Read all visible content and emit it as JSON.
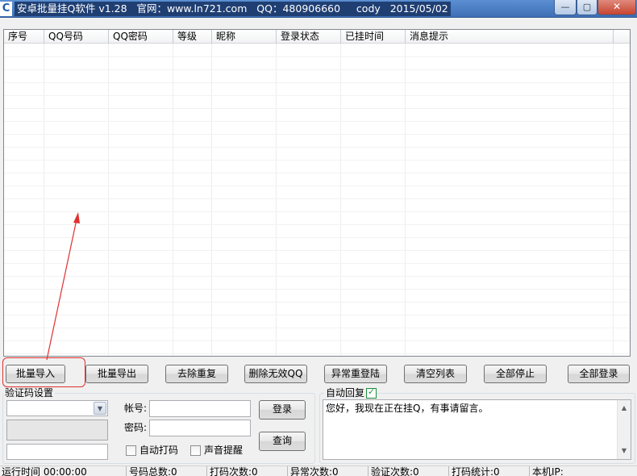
{
  "window": {
    "icon_glyph": "C",
    "title": "安卓批量挂Q软件 v1.28   官网：www.ln721.com   QQ：480906660     cody   2015/05/02",
    "min_glyph": "—",
    "max_glyph": "▢",
    "close_glyph": "✕"
  },
  "table": {
    "columns": [
      "序号",
      "QQ号码",
      "QQ密码",
      "等级",
      "昵称",
      "登录状态",
      "已挂时间",
      "消息提示"
    ],
    "rows": []
  },
  "toolbar": {
    "buttons": [
      "批量导入",
      "批量导出",
      "去除重复",
      "删除无效QQ",
      "异常重登陆",
      "清空列表",
      "全部停止",
      "全部登录"
    ]
  },
  "captcha": {
    "group_title": "验证码设置",
    "combo_value": "",
    "input_value": ""
  },
  "login": {
    "account_label": "帐号:",
    "account_value": "",
    "password_label": "密码:",
    "password_value": "",
    "login_button": "登录",
    "query_button": "查询",
    "auto_code_label": "自动打码",
    "auto_code_checked": false,
    "sound_alert_label": "声音提醒",
    "sound_alert_checked": false
  },
  "auto_reply": {
    "label": "自动回复",
    "checked": true,
    "message": "您好，我现在正在挂Q，有事请留言。"
  },
  "status": {
    "run_time": "运行时间 00:00:00",
    "total_accounts": "号码总数:0",
    "code_count": "打码次数:0",
    "error_count": "异常次数:0",
    "verify_count": "验证次数:0",
    "code_stats": "打码统计:0",
    "local_ip": "本机IP:"
  },
  "colors": {
    "title_bar": "#3e6fb6",
    "annotation": "#e03030",
    "check_green": "#1a9a3a"
  }
}
